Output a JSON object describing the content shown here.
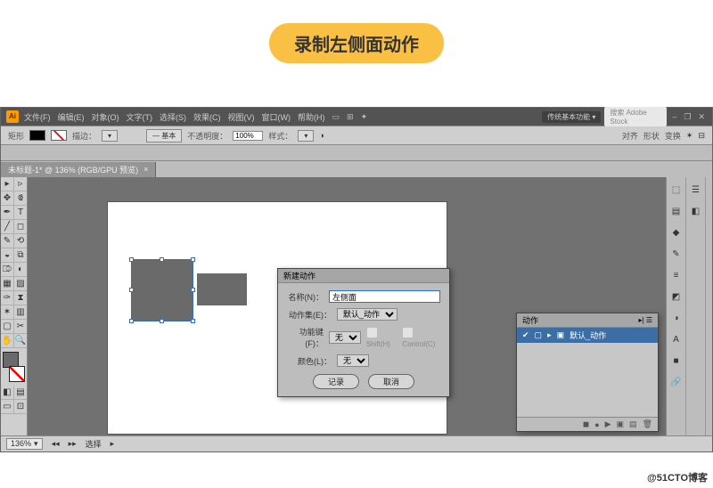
{
  "banner": "录制左侧面动作",
  "menu": {
    "items": [
      "文件(F)",
      "编辑(E)",
      "对象(O)",
      "文字(T)",
      "选择(S)",
      "效果(C)",
      "视图(V)",
      "窗口(W)",
      "帮助(H)"
    ],
    "workspace_label": "传统基本功能",
    "search_placeholder": "搜索 Adobe Stock"
  },
  "optionbar": {
    "left_label": "矩形",
    "stroke_weight_label": "描边：",
    "stroke_weight": "",
    "basic_profile": "— 基本",
    "opacity_label": "不透明度：",
    "opacity": "100%",
    "style_label": "样式：",
    "right_items": [
      "对齐",
      "形状",
      "变换"
    ]
  },
  "tab": {
    "title": "未标题-1* @ 136% (RGB/GPU 预览)"
  },
  "dialog": {
    "title": "新建动作",
    "name_label": "名称(N)：",
    "name_value": "左侧面",
    "set_label": "动作集(E)：",
    "set_value": "默认_动作",
    "fkey_label": "功能键(F)：",
    "fkey_value": "无",
    "shift_label": "Shift(H)",
    "ctrl_label": "Control(C)",
    "color_label": "颜色(L)：",
    "color_value": "无",
    "record": "记录",
    "cancel": "取消"
  },
  "actions_panel": {
    "title": "动作",
    "entry": "默认_动作"
  },
  "status": {
    "zoom": "136%",
    "selection": "选择"
  },
  "tools": [
    [
      "▸",
      "▹"
    ],
    [
      "✥",
      "✦"
    ],
    [
      "✒",
      "T"
    ],
    [
      "╱",
      "◻"
    ],
    [
      "✎",
      "⟲"
    ],
    [
      "◒",
      "⧉"
    ],
    [
      "⎄",
      "◐"
    ],
    [
      "▦",
      "▨"
    ],
    [
      "✂",
      "☷"
    ],
    [
      "✋",
      "🔍"
    ],
    [
      "⬚",
      "⬚"
    ]
  ],
  "dock_icons_left": [
    "▤",
    "⬚",
    "◆",
    "✎",
    "≡",
    "◩",
    "◑",
    "A"
  ],
  "dock_icons_right": [
    "☰",
    "◧",
    "⬚",
    "◐"
  ],
  "watermark": "@51CTO博客"
}
